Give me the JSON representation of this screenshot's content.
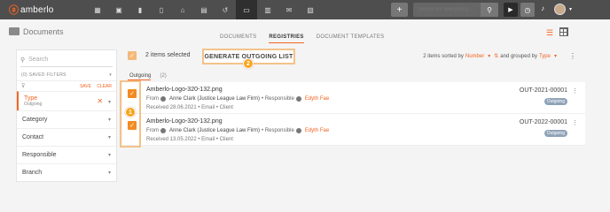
{
  "brand": {
    "name": "amberlo"
  },
  "topbar": {
    "nav_icons": [
      "grid-icon",
      "contact-icon",
      "briefcase-icon",
      "document-icon",
      "bank-icon",
      "calendar-icon",
      "history-icon",
      "folder-icon",
      "invoice-icon",
      "mail-icon",
      "chart-icon"
    ],
    "active_nav": "folder-icon",
    "search_placeholder": "Search for everything..."
  },
  "header": {
    "title": "Documents",
    "tabs": [
      {
        "label": "DOCUMENTS",
        "active": false
      },
      {
        "label": "REGISTRIES",
        "active": true
      },
      {
        "label": "DOCUMENT TEMPLATES",
        "active": false
      }
    ]
  },
  "sidebar": {
    "search_placeholder": "Search",
    "saved_filters": "(0) SAVED FILTERS",
    "save_label": "SAVE",
    "clear_label": "CLEAR",
    "type_filter": {
      "label": "Type",
      "value": "Outgoing"
    },
    "filters": [
      "Category",
      "Contact",
      "Responsible",
      "Branch"
    ]
  },
  "bulk": {
    "selected_text": "2 items selected",
    "generate_button": "GENERATE OUTGOING LIST"
  },
  "sort": {
    "count_text": "2 items sorted by",
    "sort_field": "Number",
    "grouped_text": "and grouped by",
    "group_field": "Type"
  },
  "group": {
    "name": "Outgoing",
    "count": "(2)"
  },
  "rows": [
    {
      "title": "Amberlo-Logo-320-132.png",
      "from_label": "From",
      "person": "Anne Clark (Justice League Law Firm)",
      "responsible_label": "• Responsible",
      "responsible": "Edyth Fae",
      "meta": "Received 28.06.2021 • Email • Client",
      "code": "OUT-2021-00001",
      "badge": "Outgoing"
    },
    {
      "title": "Amberlo-Logo-320-132.png",
      "from_label": "From",
      "person": "Anne Clark (Justice League Law Firm)",
      "responsible_label": "• Responsible",
      "responsible": "Edyth Fae",
      "meta": "Received 13.05.2022 • Email • Client",
      "code": "OUT-2022-00001",
      "badge": "Outgoing"
    }
  ],
  "callouts": {
    "first": "1",
    "second": "2"
  },
  "colors": {
    "accent": "#f26522",
    "topbar": "#4e4e4e",
    "callout": "#f7a51a",
    "highlight": "#f4c28a"
  }
}
